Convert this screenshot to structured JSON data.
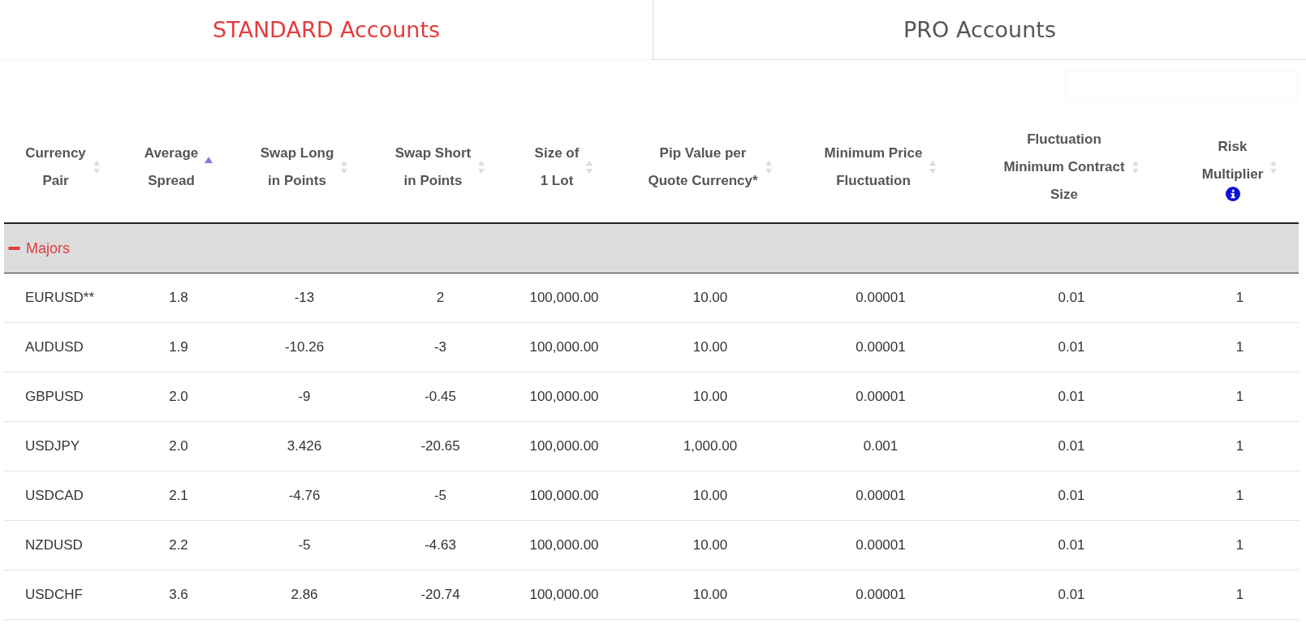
{
  "tabs": [
    {
      "label": "STANDARD Accounts",
      "selected": true
    },
    {
      "label": "PRO Accounts",
      "selected": false
    }
  ],
  "table": {
    "columns": [
      {
        "label": "Currency\nPair",
        "sorted": false,
        "info": false
      },
      {
        "label": "Average\nSpread",
        "sorted": true,
        "info": false
      },
      {
        "label": "Swap Long\nin Points",
        "sorted": false,
        "info": false
      },
      {
        "label": "Swap Short\nin Points",
        "sorted": false,
        "info": false
      },
      {
        "label": "Size of\n1 Lot",
        "sorted": false,
        "info": false
      },
      {
        "label": "Pip Value per\nQuote Currency*",
        "sorted": false,
        "info": false
      },
      {
        "label": "Minimum Price\nFluctuation",
        "sorted": false,
        "info": false
      },
      {
        "label": "Fluctuation\nMinimum Contract\nSize",
        "sorted": false,
        "info": false
      },
      {
        "label": "Risk\nMultiplier",
        "sorted": false,
        "info": true
      }
    ],
    "groups": [
      {
        "label": "Majors",
        "expanded": true,
        "rows": [
          [
            "EURUSD**",
            "1.8",
            "-13",
            "2",
            "100,000.00",
            "10.00",
            "0.00001",
            "0.01",
            "1"
          ],
          [
            "AUDUSD",
            "1.9",
            "-10.26",
            "-3",
            "100,000.00",
            "10.00",
            "0.00001",
            "0.01",
            "1"
          ],
          [
            "GBPUSD",
            "2.0",
            "-9",
            "-0.45",
            "100,000.00",
            "10.00",
            "0.00001",
            "0.01",
            "1"
          ],
          [
            "USDJPY",
            "2.0",
            "3.426",
            "-20.65",
            "100,000.00",
            "1,000.00",
            "0.001",
            "0.01",
            "1"
          ],
          [
            "USDCAD",
            "2.1",
            "-4.76",
            "-5",
            "100,000.00",
            "10.00",
            "0.00001",
            "0.01",
            "1"
          ],
          [
            "NZDUSD",
            "2.2",
            "-5",
            "-4.63",
            "100,000.00",
            "10.00",
            "0.00001",
            "0.01",
            "1"
          ],
          [
            "USDCHF",
            "3.6",
            "2.86",
            "-20.74",
            "100,000.00",
            "10.00",
            "0.00001",
            "0.01",
            "1"
          ]
        ]
      }
    ]
  }
}
